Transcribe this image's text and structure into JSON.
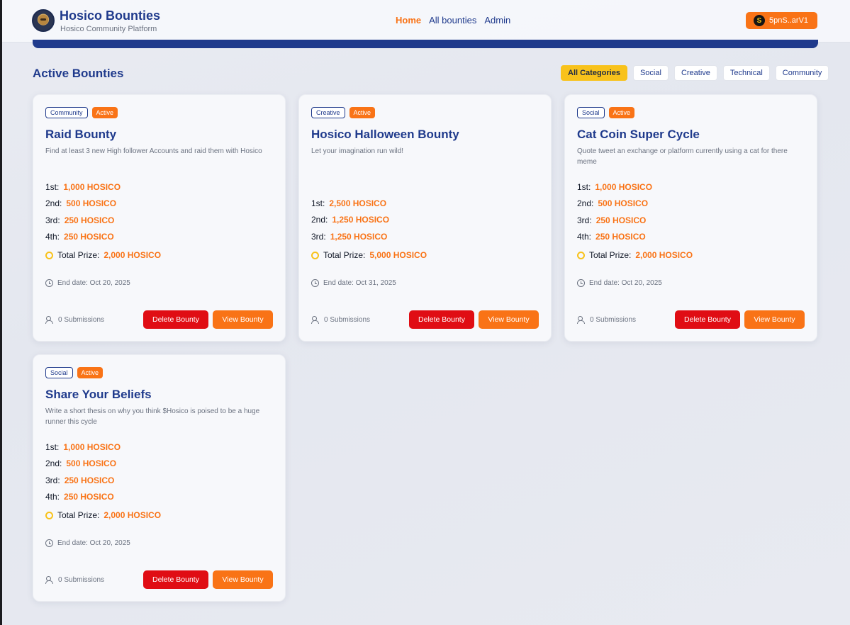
{
  "header": {
    "title": "Hosico Bounties",
    "subtitle": "Hosico Community Platform",
    "nav": [
      "Home",
      "All bounties",
      "Admin"
    ],
    "wallet_label": "5pnS..arV1"
  },
  "main": {
    "heading": "Active Bounties",
    "filters": [
      "All Categories",
      "Social",
      "Creative",
      "Technical",
      "Community"
    ],
    "active_filter": "All Categories"
  },
  "labels": {
    "total_prize": "Total Prize:",
    "delete": "Delete Bounty",
    "view": "View Bounty"
  },
  "bounties": [
    {
      "category": "Community",
      "status": "Active",
      "title": "Raid Bounty",
      "description": "Find at least 3 new High follower Accounts and raid them with Hosico",
      "prizes": [
        {
          "place": "1st:",
          "amount": "1,000 HOSICO"
        },
        {
          "place": "2nd:",
          "amount": "500 HOSICO"
        },
        {
          "place": "3rd:",
          "amount": "250 HOSICO"
        },
        {
          "place": "4th:",
          "amount": "250 HOSICO"
        }
      ],
      "total": "2,000 HOSICO",
      "end_date": "End date: Oct 20, 2025",
      "submissions": "0 Submissions"
    },
    {
      "category": "Creative",
      "status": "Active",
      "title": "Hosico Halloween Bounty",
      "description": "Let your imagination run wild!",
      "prizes": [
        {
          "place": "1st:",
          "amount": "2,500 HOSICO"
        },
        {
          "place": "2nd:",
          "amount": "1,250 HOSICO"
        },
        {
          "place": "3rd:",
          "amount": "1,250 HOSICO"
        }
      ],
      "total": "5,000 HOSICO",
      "end_date": "End date: Oct 31, 2025",
      "submissions": "0 Submissions"
    },
    {
      "category": "Social",
      "status": "Active",
      "title": "Cat Coin Super Cycle",
      "description": "Quote tweet an exchange or platform currently using a cat for there meme",
      "prizes": [
        {
          "place": "1st:",
          "amount": "1,000 HOSICO"
        },
        {
          "place": "2nd:",
          "amount": "500 HOSICO"
        },
        {
          "place": "3rd:",
          "amount": "250 HOSICO"
        },
        {
          "place": "4th:",
          "amount": "250 HOSICO"
        }
      ],
      "total": "2,000 HOSICO",
      "end_date": "End date: Oct 20, 2025",
      "submissions": "0 Submissions"
    },
    {
      "category": "Social",
      "status": "Active",
      "title": "Share Your Beliefs",
      "description": "Write a short thesis on why you think $Hosico is poised to be a huge runner this cycle",
      "prizes": [
        {
          "place": "1st:",
          "amount": "1,000 HOSICO"
        },
        {
          "place": "2nd:",
          "amount": "500 HOSICO"
        },
        {
          "place": "3rd:",
          "amount": "250 HOSICO"
        },
        {
          "place": "4th:",
          "amount": "250 HOSICO"
        }
      ],
      "total": "2,000 HOSICO",
      "end_date": "End date: Oct 20, 2025",
      "submissions": "0 Submissions"
    }
  ],
  "colors": {
    "brand_blue": "#1f3a8c",
    "accent_orange": "#f97316",
    "delete_red": "#e00d14",
    "filter_yellow": "#f8c21b"
  }
}
